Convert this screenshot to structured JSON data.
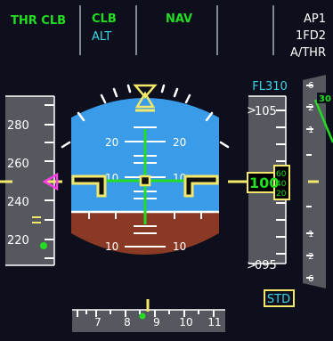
{
  "fma": {
    "col1": {
      "line1": "THR CLB"
    },
    "col2": {
      "line1": "CLB",
      "line2": "ALT"
    },
    "col3": {
      "line1": "NAV"
    },
    "col5": {
      "line1": "AP1",
      "line2": "1FD2",
      "line3": "A/THR"
    }
  },
  "speed_tape": {
    "ticks": [
      "280",
      "260",
      "240",
      "220"
    ]
  },
  "attitude": {
    "pitch_labels_upper_20_left": "20",
    "pitch_labels_upper_20_right": "20",
    "pitch_labels_upper_10_left": "10",
    "pitch_labels_upper_10_right": "10",
    "pitch_labels_lower_10_left": "10",
    "pitch_labels_lower_10_right": "10"
  },
  "altitude_tape": {
    "selected_alt": "FL310",
    "upper_mark": "105",
    "current_alt_main": "100",
    "drum_upper": "60",
    "drum_mid": "40",
    "drum_lower": "20",
    "lower_mark": "095",
    "baro": "STD"
  },
  "vs_scale": {
    "upper_6": "6",
    "upper_2": "2",
    "upper_1": "1",
    "lower_1": "1",
    "lower_2": "2",
    "lower_6": "6",
    "vs_value": "30"
  },
  "heading_tape": {
    "labels": [
      "7",
      "8",
      "9",
      "10",
      "11"
    ]
  },
  "colors": {
    "sky": "#3a9be8",
    "ground": "#8a3a24",
    "green": "#22dd22",
    "cyan": "#3ad5e8",
    "yellow": "#f4e86a",
    "magenta": "#ff3ee8",
    "white": "#ffffff",
    "tape_bg": "#55585f"
  }
}
